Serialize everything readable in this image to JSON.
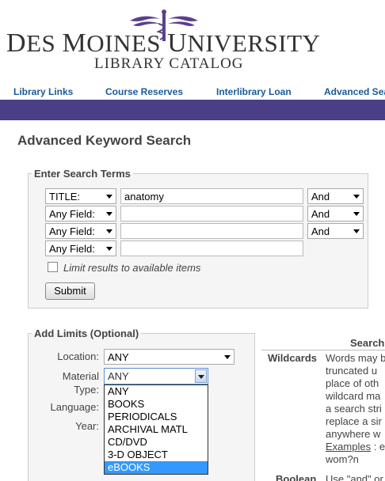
{
  "header": {
    "university_name_1": "D",
    "university_name_2": "ES ",
    "university_name_3": "M",
    "university_name_4": "OINES ",
    "university_name_5": "U",
    "university_name_6": "NIVERSITY",
    "catalog_title": "LIBRARY CATALOG",
    "brand_color": "#4a3e86"
  },
  "nav": {
    "items": [
      "Library Links",
      "Course Reserves",
      "Interlibrary Loan",
      "Advanced Search"
    ]
  },
  "page_title": "Advanced Keyword Search",
  "search_terms": {
    "legend": "Enter Search Terms",
    "rows": [
      {
        "field": "TITLE:",
        "value": "anatomy",
        "operator": "And"
      },
      {
        "field": "Any Field:",
        "value": "",
        "operator": "And"
      },
      {
        "field": "Any Field:",
        "value": "",
        "operator": "And"
      },
      {
        "field": "Any Field:",
        "value": ""
      }
    ],
    "limit_label": "Limit results to available items",
    "submit_label": "Submit"
  },
  "limits": {
    "legend": "Add Limits (Optional)",
    "location_label": "Location:",
    "location_value": "ANY",
    "material_label_1": "Material",
    "material_label_2": "Type:",
    "material_value": "ANY",
    "language_label": "Language:",
    "year_label": "Year:",
    "material_options": [
      "ANY",
      "BOOKS",
      "PERIODICALS",
      "ARCHIVAL MATL",
      "CD/DVD",
      "3-D OBJECT",
      "eBOOKS"
    ],
    "highlighted_option": "eBOOKS"
  },
  "help": {
    "title": "Search",
    "wildcards_term": "Wildcards",
    "wildcards_lines": [
      "Words may b",
      "truncated u",
      "place of oth",
      "wildcard ma",
      "a search stri",
      "replace a sir",
      "anywhere w"
    ],
    "examples_label": "Examples",
    "examples_rest": " : e",
    "examples_line2": "wom?n",
    "boolean_term": "Boolean",
    "boolean_text": "Use \"and\" or"
  }
}
